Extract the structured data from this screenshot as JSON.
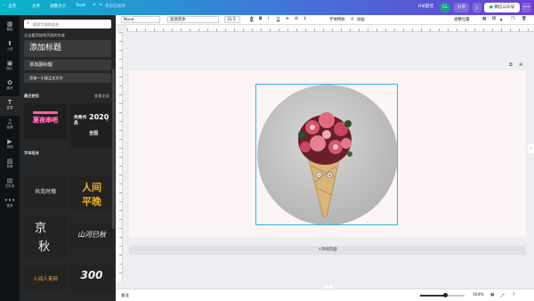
{
  "topbar": {
    "home": "主页",
    "file": "文件",
    "resize": "调整大小",
    "tools": "Tools",
    "save_status": "年份已保存",
    "subscription": "B试最佳",
    "avatar": "CL",
    "share": "分享",
    "publish": "微信公众号",
    "more": "•••"
  },
  "rail": [
    {
      "icon": "▦",
      "label": "模板"
    },
    {
      "icon": "⬆",
      "label": "上传"
    },
    {
      "icon": "▣",
      "label": "照片"
    },
    {
      "icon": "✿",
      "label": "素材"
    },
    {
      "icon": "T",
      "label": "文字"
    },
    {
      "icon": "♫",
      "label": "音频"
    },
    {
      "icon": "▶",
      "label": "视频"
    },
    {
      "icon": "▨",
      "label": "背景"
    },
    {
      "icon": "▤",
      "label": "文件夹"
    },
    {
      "icon": "•••",
      "label": "更多"
    }
  ],
  "panel": {
    "search_placeholder": "搜索字体和组合",
    "hint": "点击要添加到页面的文本",
    "add_title": "添加标题",
    "add_subtitle": "添加副标题",
    "add_body": "添加一小段正文文字",
    "recent_label": "最近使用",
    "see_all": "查看全部",
    "recent_1": "夏夜串吧",
    "recent_2_year": "2020",
    "recent_2_text": "优秀作品",
    "recent_3_text": "全国",
    "combos_label": "字体组合",
    "combo_1": "共克时艰",
    "combo_2_line1": "人间",
    "combo_2_line2": "平晚",
    "combo_3_line1": "京",
    "combo_3_line2": "秋",
    "combo_4": "山河已秋",
    "combo_5": "人间人来网",
    "combo_6": "300"
  },
  "toolbar": {
    "font": "None",
    "font2": "思源黑体",
    "size": "31.5",
    "effects": "字体特效",
    "animate": "动画",
    "position": "调整位置"
  },
  "canvas": {
    "add_page": "+添加页面"
  },
  "bottombar": {
    "notes": "备注",
    "zoom": "164%"
  },
  "colors": {
    "accent": "#2fb6d8",
    "page_bg": "#fdf4f6"
  }
}
